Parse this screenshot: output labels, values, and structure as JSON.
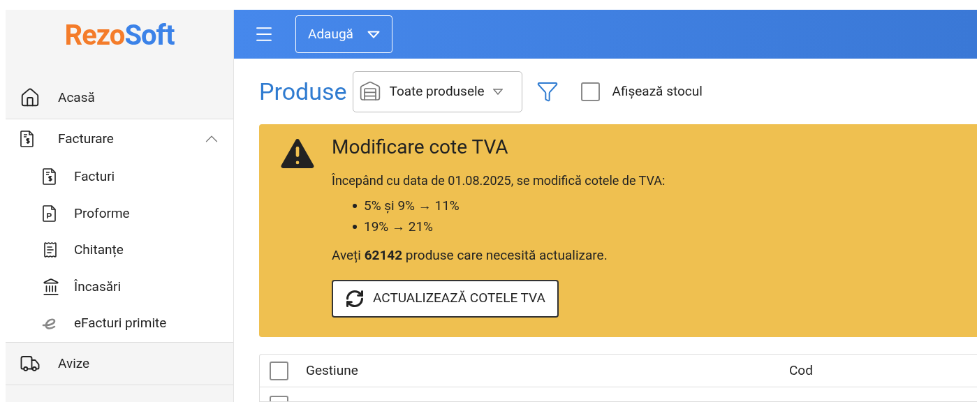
{
  "logo": {
    "parts": [
      "Rezo",
      "Soft"
    ]
  },
  "sidebar": {
    "items": [
      {
        "label": "Acasă",
        "kind": "link",
        "selected": false
      },
      {
        "label": "Facturare",
        "kind": "group",
        "expanded": true,
        "children": [
          {
            "label": "Facturi"
          },
          {
            "label": "Proforme"
          },
          {
            "label": "Chitanțe"
          },
          {
            "label": "Încasări"
          },
          {
            "label": "eFacturi primite"
          }
        ]
      },
      {
        "label": "Avize",
        "kind": "link",
        "selected": false
      }
    ]
  },
  "header": {
    "add_button": "Adaugă"
  },
  "page": {
    "title": "Produse",
    "filter_select": "Toate produsele",
    "show_stock": {
      "label": "Afișează stocul",
      "checked": false
    }
  },
  "alert": {
    "title": "Modificare cote TVA",
    "intro": "Începând cu data de 01.08.2025, se modifică cotele de TVA:",
    "bullets": [
      "5% și 9% → 11%",
      "19% → 21%"
    ],
    "summary": "Aveți **62142** produse care necesită actualizare.",
    "button": "ACTUALIZEAZĂ COTELE TVA"
  },
  "table": {
    "columns": [
      {
        "label": "Gestiune"
      },
      {
        "label": "Cod"
      }
    ],
    "header_checked": false,
    "first_row_checked": false
  }
}
